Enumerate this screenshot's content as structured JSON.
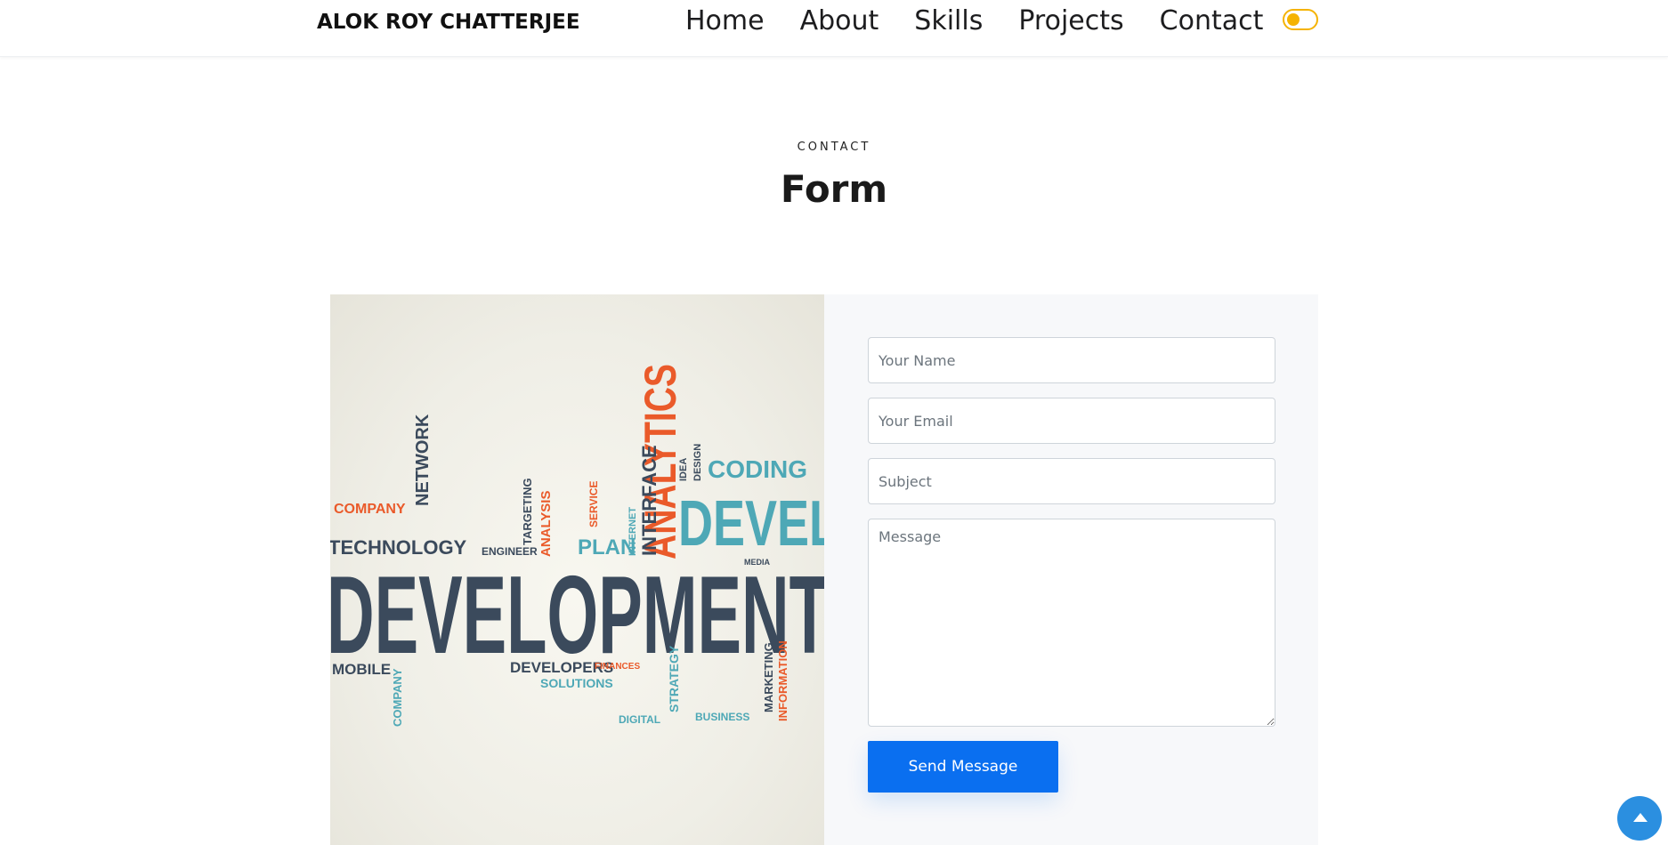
{
  "header": {
    "brand": "ALOK ROY CHATTERJEE",
    "nav": [
      "Home",
      "About",
      "Skills",
      "Projects",
      "Contact"
    ],
    "theme_toggle_icon": "toggle-switch-icon"
  },
  "section": {
    "kicker": "CONTACT",
    "title": "Form"
  },
  "image": {
    "description_icon": "development-word-cloud-image",
    "words": {
      "main": "DEVELOPMENT",
      "analytics": "ANALYTICS",
      "coding": "CODING",
      "devel": "DEVEL",
      "technology": "TECHNOLOGY",
      "plan": "PLAN",
      "interface": "INTERFACE",
      "network": "NETWORK",
      "company": "COMPANY",
      "developers": "DEVELOPERS",
      "solutions": "SOLUTIONS",
      "mobile": "MOBILE",
      "business": "BUSINESS",
      "marketing": "MARKETING",
      "information": "INFORMATION",
      "strategy": "STRATEGY",
      "finances": "FINANCES",
      "digital": "DIGITAL",
      "engineer": "ENGINEER",
      "analysis": "ANALYSIS",
      "targeting": "TARGETING",
      "service": "SERVICE",
      "internet": "INTERNET",
      "design": "DESIGN",
      "idea": "IDEA",
      "media": "MEDIA"
    }
  },
  "form": {
    "name_placeholder": "Your Name",
    "email_placeholder": "Your Email",
    "subject_placeholder": "Subject",
    "message_placeholder": "Message",
    "send_label": "Send Message"
  },
  "colors": {
    "accent": "#0a6ff0",
    "toggle": "#f5b300",
    "card_bg": "#f7f8fa"
  },
  "back_to_top_icon": "arrow-up-icon"
}
